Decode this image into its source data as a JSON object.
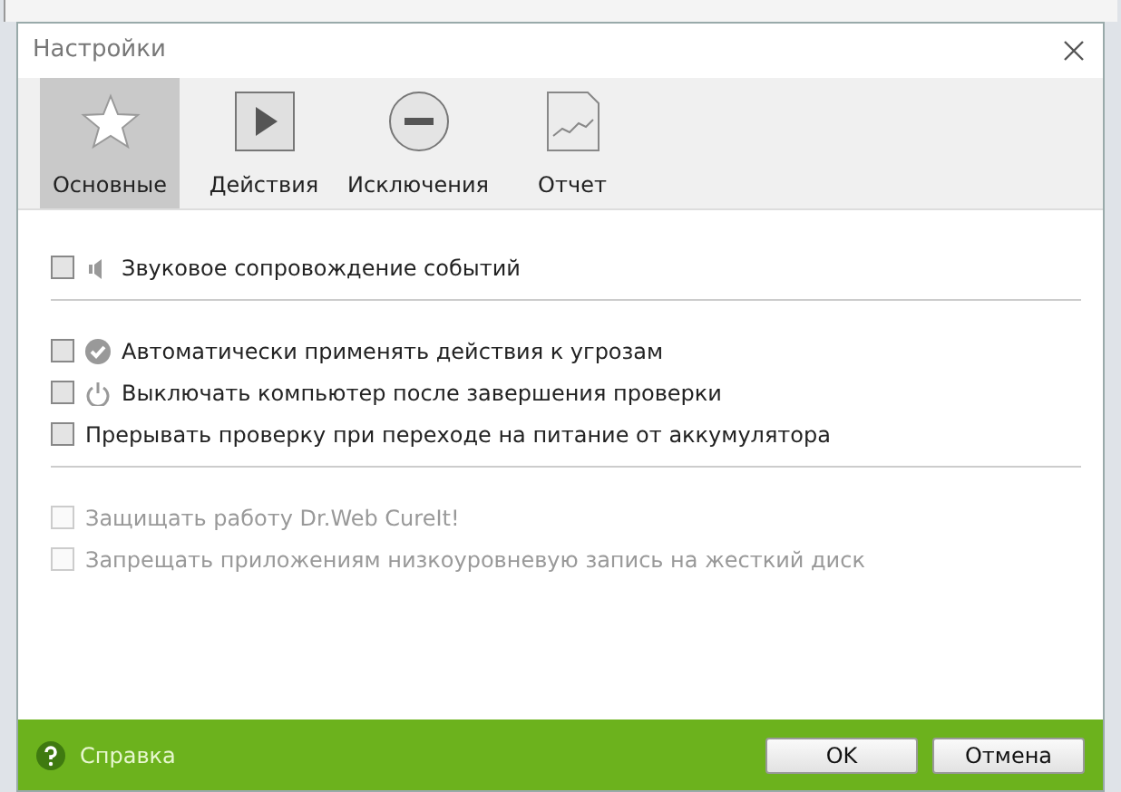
{
  "dialog": {
    "title": "Настройки"
  },
  "tabs": [
    {
      "label": "Основные",
      "kind": "star",
      "selected": true
    },
    {
      "label": "Действия",
      "kind": "play",
      "selected": false
    },
    {
      "label": "Исключения",
      "kind": "minus",
      "selected": false
    },
    {
      "label": "Отчет",
      "kind": "report",
      "selected": false
    }
  ],
  "option_groups": [
    [
      {
        "label": "Звуковое сопровождение событий",
        "kind": "sound",
        "checked": false,
        "disabled": false
      }
    ],
    [
      {
        "label": "Автоматически применять действия к угрозам",
        "kind": "check",
        "checked": false,
        "disabled": false
      },
      {
        "label": "Выключать компьютер после завершения проверки",
        "kind": "power",
        "checked": false,
        "disabled": false
      },
      {
        "label": "Прерывать проверку при переходе на питание от аккумулятора",
        "checked": false,
        "disabled": false
      }
    ],
    [
      {
        "label": "Защищать работу Dr.Web CureIt!",
        "checked": false,
        "disabled": true
      },
      {
        "label": "Запрещать приложениям низкоуровневую запись на жесткий диск",
        "checked": false,
        "disabled": true
      }
    ]
  ],
  "footer": {
    "help_link": "Справка",
    "buttons": [
      "OK",
      "Отмена"
    ]
  }
}
